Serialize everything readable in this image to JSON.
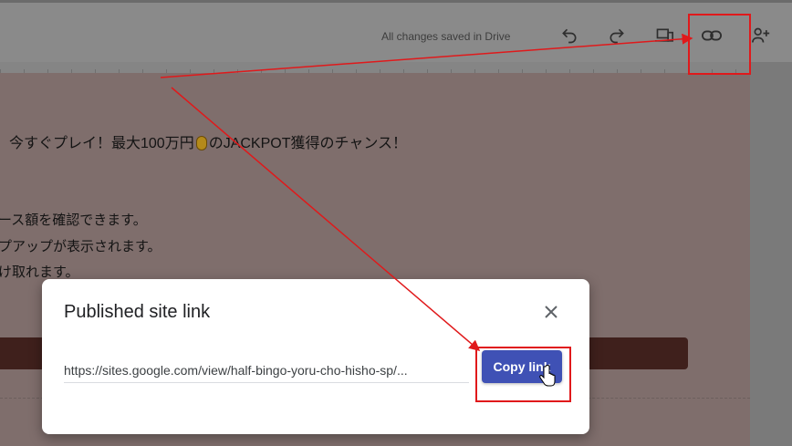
{
  "toolbar": {
    "status_text": "All changes saved in Drive",
    "icons": [
      "undo-icon",
      "redo-icon",
      "preview-devices-icon",
      "link-icon",
      "share-icon"
    ]
  },
  "page": {
    "headline_before": "今すぐプレイ！最大100万円",
    "headline_after": "のJACKPOT獲得のチャンス！",
    "lines": [
      "ース額を確認できます。",
      "プアップが表示されます。",
      "け取れます。"
    ]
  },
  "dialog": {
    "title": "Published site link",
    "url": "https://sites.google.com/view/half-bingo-yoru-cho-hisho-sp/...",
    "copy_label": "Copy link"
  },
  "colors": {
    "accent": "#3f51b5",
    "annotation": "#e0191b"
  }
}
